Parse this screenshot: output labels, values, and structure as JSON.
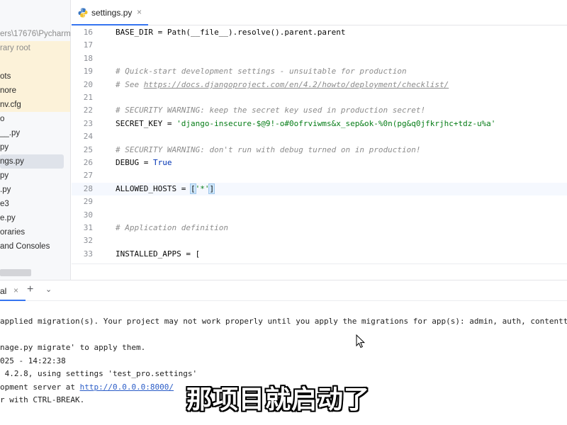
{
  "sidebar": {
    "items": [
      {
        "label": "ers\\17676\\Pycharm",
        "style": "dim"
      },
      {
        "label": "rary root",
        "style": "hl-dim"
      },
      {
        "label": "",
        "style": "hl"
      },
      {
        "label": "ots",
        "style": "hl"
      },
      {
        "label": "nore",
        "style": "hl"
      },
      {
        "label": "nv.cfg",
        "style": "hl"
      },
      {
        "label": "o",
        "style": ""
      },
      {
        "label": "__.py",
        "style": ""
      },
      {
        "label": "py",
        "style": ""
      },
      {
        "label": "ngs.py",
        "style": "sel"
      },
      {
        "label": "py",
        "style": ""
      },
      {
        "label": ".py",
        "style": ""
      },
      {
        "label": "e3",
        "style": ""
      },
      {
        "label": "e.py",
        "style": ""
      },
      {
        "label": "oraries",
        "style": ""
      },
      {
        "label": "and Consoles",
        "style": ""
      }
    ]
  },
  "editor": {
    "tab_label": "settings.py",
    "tab_close": "×",
    "lines": [
      {
        "n": "16",
        "code": "BASE_DIR = Path(__file__).resolve().parent.parent"
      },
      {
        "n": "17",
        "code": ""
      },
      {
        "n": "18",
        "code": ""
      },
      {
        "n": "19",
        "code": "# Quick-start development settings - unsuitable for production"
      },
      {
        "n": "20",
        "pre": "# See ",
        "link": "https://docs.djangoproject.com/en/4.2/howto/deployment/checklist/"
      },
      {
        "n": "21",
        "code": ""
      },
      {
        "n": "22",
        "code": "# SECURITY WARNING: keep the secret key used in production secret!"
      },
      {
        "n": "23",
        "pre": "SECRET_KEY = ",
        "str": "'django-insecure-$@9!-o#0ofrviwms&x_sep&ok-%0n(pg&q0jfkrjhc+tdz-u%a'"
      },
      {
        "n": "24",
        "code": ""
      },
      {
        "n": "25",
        "code": "# SECURITY WARNING: don't run with debug turned on in production!"
      },
      {
        "n": "26",
        "pre": "DEBUG = ",
        "kw": "True"
      },
      {
        "n": "27",
        "code": ""
      },
      {
        "n": "28",
        "pre": "ALLOWED_HOSTS = ",
        "b1": "[",
        "str": "'*'",
        "b2": "]"
      },
      {
        "n": "29",
        "code": ""
      },
      {
        "n": "30",
        "code": ""
      },
      {
        "n": "31",
        "code": "# Application definition"
      },
      {
        "n": "32",
        "code": ""
      },
      {
        "n": "33",
        "code": "INSTALLED_APPS = ["
      }
    ]
  },
  "terminal": {
    "tab_label": "al",
    "close": "×",
    "add": "+",
    "menu": "⌄",
    "lines": [
      {
        "text": "applied migration(s). Your project may not work properly until you apply the migrations for app(s): admin, auth, contentty"
      },
      {
        "text": ""
      },
      {
        "text": "nage.py migrate' to apply them."
      },
      {
        "text": "025 - 14:22:38"
      },
      {
        "text": " 4.2.8, using settings 'test_pro.settings'"
      },
      {
        "pre": "opment server at ",
        "link": "http://0.0.0.0:8000/"
      },
      {
        "text": "r with CTRL-BREAK."
      }
    ]
  },
  "subtitle": "那项目就启动了",
  "colors": {
    "accent": "#3574f0",
    "string": "#067d17",
    "keyword": "#0033b3",
    "comment": "#8c8c8c",
    "highlight": "#fcf2d9"
  }
}
